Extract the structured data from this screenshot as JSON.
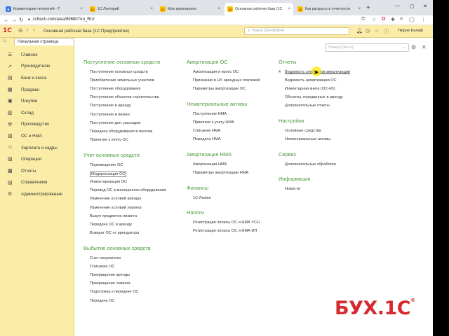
{
  "browser": {
    "tabs": [
      {
        "title": "Комментарии читателей - Т",
        "favicon": "blue"
      },
      {
        "title": "1С:Лекторий",
        "favicon": "yellow"
      },
      {
        "title": "Мои приложения",
        "favicon": "yellow"
      },
      {
        "title": "Основная рабочая база (1С",
        "favicon": "yellow",
        "active": true
      },
      {
        "title": "Как раскрыть в отчетности",
        "favicon": "yellow"
      }
    ],
    "url": "1cfresh.com/a/ea/996807/ru_RU/"
  },
  "app": {
    "logo": "1С",
    "base_title": "Основная рабочая база (1С:Предприятие)",
    "search_placeholder": "Поиск Ctrl+Shift+F",
    "user": "Пюрне Белиф",
    "home_tab": "Начальная страница",
    "main_search_placeholder": "Поиск (Ctrl+F)"
  },
  "sidebar": {
    "items": [
      {
        "label": "Главное",
        "icon": "list-icon"
      },
      {
        "label": "Руководителю",
        "icon": "chart-icon"
      },
      {
        "label": "Банк и касса",
        "icon": "bank-icon"
      },
      {
        "label": "Продажи",
        "icon": "sales-icon"
      },
      {
        "label": "Покупки",
        "icon": "cart-icon"
      },
      {
        "label": "Склад",
        "icon": "warehouse-icon"
      },
      {
        "label": "Производство",
        "icon": "factory-icon"
      },
      {
        "label": "ОС и НМА",
        "icon": "assets-icon"
      },
      {
        "label": "Зарплата и кадры",
        "icon": "people-icon"
      },
      {
        "label": "Операции",
        "icon": "operations-icon"
      },
      {
        "label": "Отчеты",
        "icon": "reports-icon"
      },
      {
        "label": "Справочники",
        "icon": "books-icon"
      },
      {
        "label": "Администрирование",
        "icon": "gear-icon"
      }
    ]
  },
  "sections": {
    "col1": [
      {
        "title": "Поступление основных средств",
        "links": [
          "Поступление основных средств",
          "Приобретение земельных участков",
          "Поступление оборудования",
          "Поступление объектов строительства",
          "Поступление в аренду",
          "Поступление в лизинг",
          "Поступление доп. расходов",
          "Передача оборудования в монтаж",
          "Принятие к учету ОС"
        ]
      },
      {
        "title": "Учет основных средств",
        "links": [
          "Перемещение ОС",
          "Модернизация ОС",
          "Инвентаризация ОС",
          "Перевод ОС в малоценное оборудование",
          "Изменение условий аренды",
          "Изменение условий лизинга",
          "Выкуп предметов лизинга",
          "Передача ОС в аренду",
          "Возврат ОС от арендатора"
        ]
      },
      {
        "title": "Выбытие основных средств",
        "links": [
          "Счет покупателю",
          "Списание ОС",
          "Прекращение аренды",
          "Прекращение лизинга",
          "Подготовка к передаче ОС",
          "Передача ОС"
        ]
      }
    ],
    "col2": [
      {
        "title": "Амортизация ОС",
        "links": [
          "Амортизация и износ ОС",
          "Признание в НУ арендных платежей",
          "Параметры амортизации ОС"
        ]
      },
      {
        "title": "Нематериальные активы",
        "links": [
          "Поступление НМА",
          "Принятие к учету НМА",
          "Списание НМА",
          "Передача НМА"
        ]
      },
      {
        "title": "Амортизация НМА",
        "links": [
          "Амортизация НМА",
          "Параметры амортизации НМА"
        ]
      },
      {
        "title": "Финансы",
        "links": [
          "1С:Лизинг"
        ]
      },
      {
        "title": "Налоги",
        "links": [
          "Регистрация оплаты ОС и НМА УСН",
          "Регистрация оплаты ОС и НМА ИП"
        ]
      }
    ],
    "col3": [
      {
        "title": "Отчеты",
        "links": [
          "Ведомость элементов амортизации",
          "Ведомость амортизации ОС",
          "Инвентарная книга (ОС-6б)",
          "Объекты, переданные в аренду",
          "Дополнительные отчеты"
        ]
      },
      {
        "title": "Настройки",
        "links": [
          "Основные средства",
          "Нематериальные активы"
        ]
      },
      {
        "title": "Сервис",
        "links": [
          "Дополнительные обработки"
        ]
      },
      {
        "title": "Информация",
        "links": [
          "Новости"
        ]
      }
    ]
  },
  "watermark": {
    "text": "БУХ.1С",
    "mark": "®"
  },
  "colors": {
    "header_bg": "#fbeda7",
    "section_green": "#4a9a3b",
    "brand_red": "#d62a2f"
  }
}
